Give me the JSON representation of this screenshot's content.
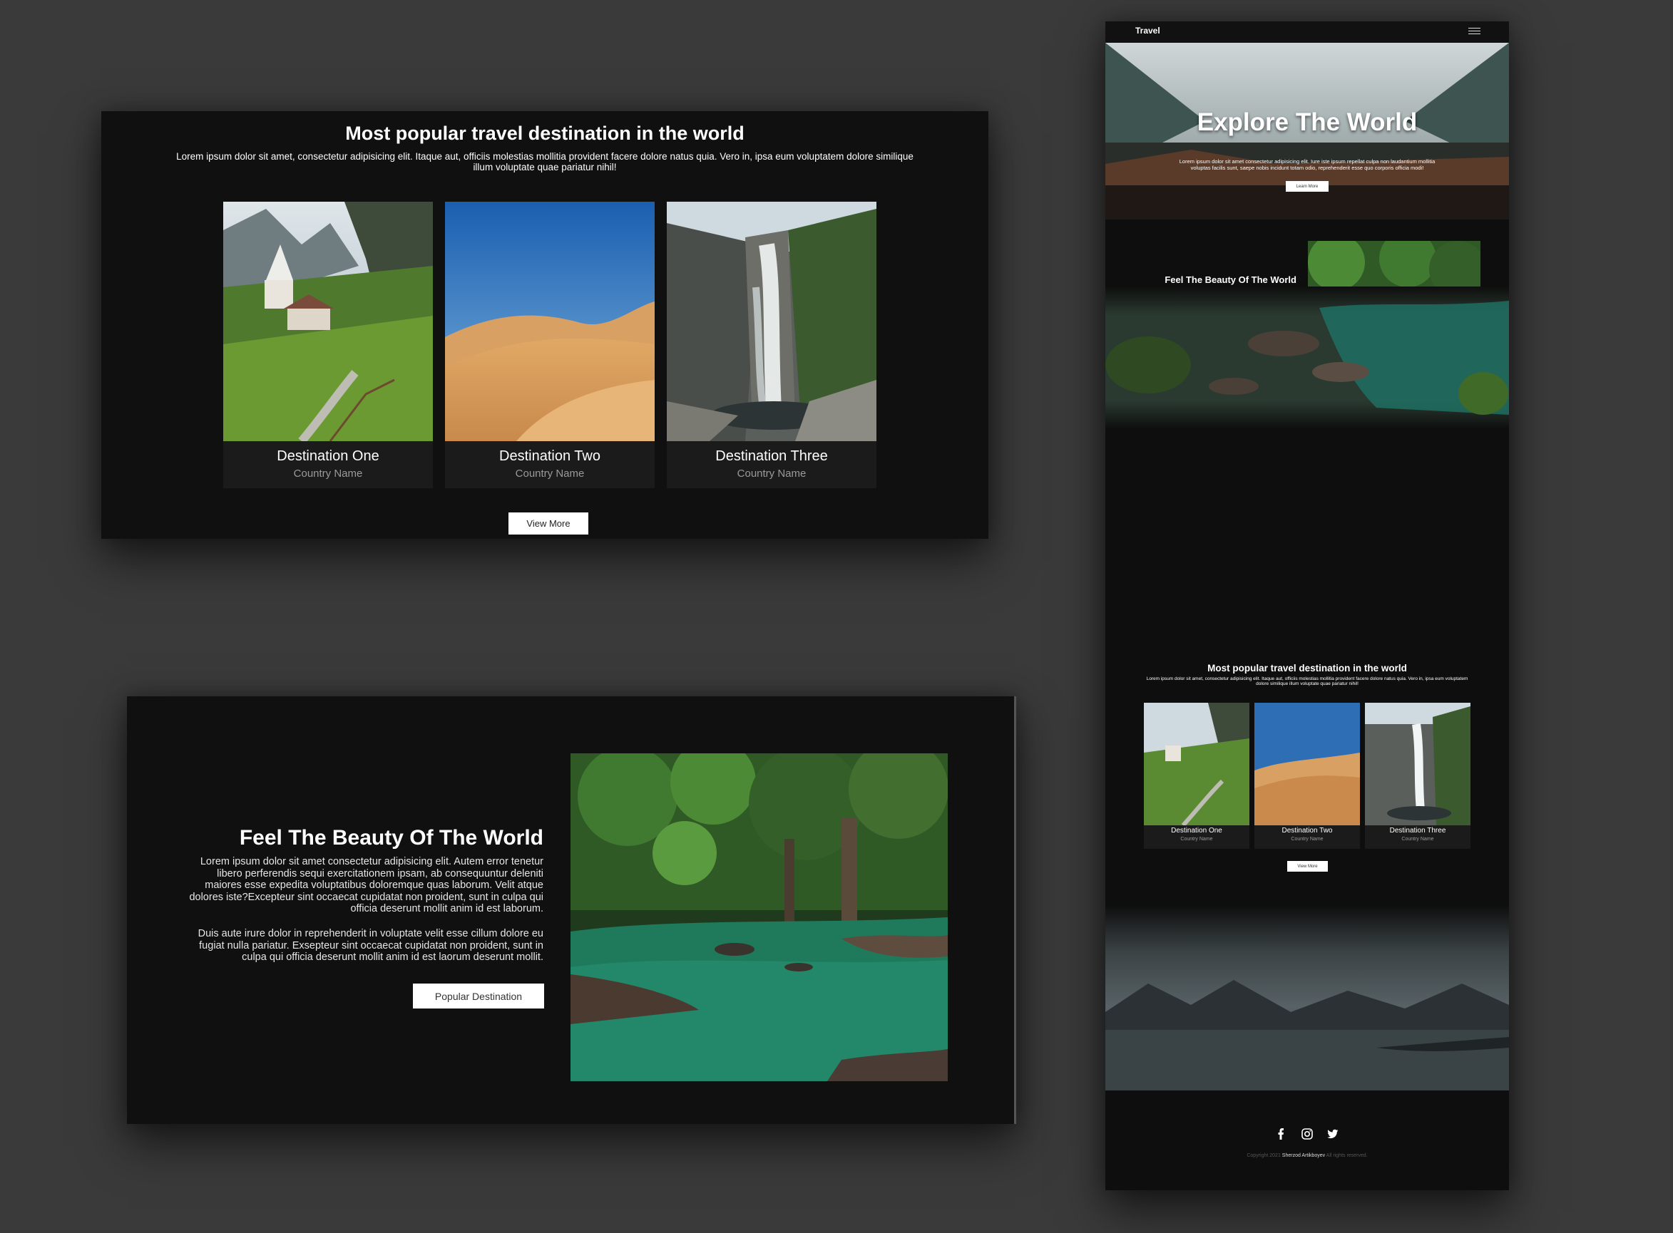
{
  "popular": {
    "title": "Most popular travel destination in the world",
    "subtitle": "Lorem ipsum dolor sit amet, consectetur adipisicing elit. Itaque aut, officiis molestias mollitia provident facere dolore natus quia. Vero in, ipsa eum voluptatem dolore similique illum voluptate quae pariatur nihil!",
    "destinations": [
      {
        "name": "Destination One",
        "country": "Country Name"
      },
      {
        "name": "Destination Two",
        "country": "Country Name"
      },
      {
        "name": "Destination Three",
        "country": "Country Name"
      }
    ],
    "view_more_label": "View More"
  },
  "feel": {
    "title": "Feel The Beauty Of The World",
    "para1": "Lorem ipsum dolor sit amet consectetur adipisicing elit. Autem error tenetur libero perferendis sequi exercitationem ipsam, ab consequuntur deleniti maiores esse expedita voluptatibus doloremque quas laborum. Velit atque dolores iste?Excepteur sint occaecat cupidatat non proident, sunt in culpa qui officia deserunt mollit anim id est laborum.",
    "para2": "Duis aute irure dolor in reprehenderit in voluptate velit esse cillum dolore eu fugiat nulla pariatur. Exsepteur sint occaecat cupidatat non proident, sunt in culpa qui officia deserunt mollit anim id est laorum deserunt mollit.",
    "button_label": "Popular Destination"
  },
  "mobile": {
    "brand": "Travel",
    "hero": {
      "title": "Explore The World",
      "subtitle": "Lorem ipsum dolor sit amet consectetur adipisicing elit. Iure iste ipsum repellat culpa non laudantium mollitia voluptas facilis sunt, saepe nobis incidunt totam odio, reprehenderit esse quo corporis officia modi!",
      "button_label": "Learn More"
    },
    "footer": {
      "copyright_prefix": "Copyright 2021",
      "author": "Sherzod Artikboyev",
      "copyright_suffix": "All rights reserved."
    }
  },
  "colors": {
    "page_background": "#3a3a3a",
    "panel_background": "#101010",
    "card_background": "#1b1b1b",
    "button_background": "#ffffff"
  },
  "icons": [
    "menu-icon",
    "facebook-icon",
    "instagram-icon",
    "twitter-icon"
  ]
}
